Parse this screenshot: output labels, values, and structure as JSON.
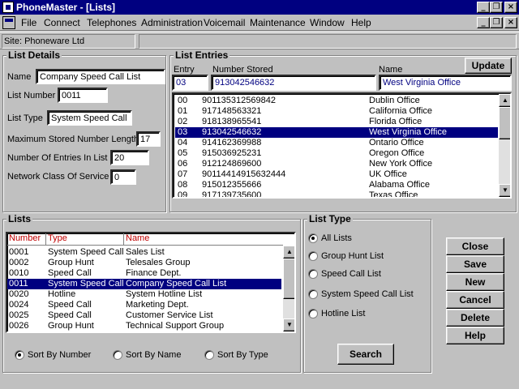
{
  "window": {
    "title": "PhoneMaster - [Lists]"
  },
  "menu": [
    "File",
    "Connect",
    "Telephones",
    "Administration",
    "Voicemail",
    "Maintenance",
    "Window",
    "Help"
  ],
  "site": {
    "label": "Site: Phoneware Ltd"
  },
  "list_details": {
    "title": "List Details",
    "name_label": "Name",
    "name_value": "Company Speed Call List",
    "number_label": "List Number",
    "number_value": "0011",
    "type_label": "List Type",
    "type_value": "System Speed Call",
    "max_len_label": "Maximum Stored Number Length",
    "max_len_value": "17",
    "entries_label": "Number Of Entries In List",
    "entries_value": "20",
    "ncos_label": "Network Class Of Service",
    "ncos_value": "0"
  },
  "list_entries": {
    "title": "List Entries",
    "update_label": "Update",
    "col_entry": "Entry",
    "col_number": "Number Stored",
    "col_name": "Name",
    "edit_entry": "03",
    "edit_number": "913042546632",
    "edit_name": "West Virginia Office",
    "rows": [
      {
        "entry": "00",
        "number": "901135312569842",
        "name": "Dublin Office"
      },
      {
        "entry": "01",
        "number": "917148563321",
        "name": "California Office"
      },
      {
        "entry": "02",
        "number": "918138965541",
        "name": "Florida Office"
      },
      {
        "entry": "03",
        "number": "913042546632",
        "name": "West Virginia Office"
      },
      {
        "entry": "04",
        "number": "914162369988",
        "name": "Ontario Office"
      },
      {
        "entry": "05",
        "number": "915036925231",
        "name": "Oregon Office"
      },
      {
        "entry": "06",
        "number": "912124869600",
        "name": "New York Office"
      },
      {
        "entry": "07",
        "number": "90114414915632444",
        "name": "UK Office"
      },
      {
        "entry": "08",
        "number": "915012355666",
        "name": "Alabama Office"
      },
      {
        "entry": "09",
        "number": "917139735600",
        "name": "Texas Office"
      }
    ],
    "selected_index": 3
  },
  "lists": {
    "title": "Lists",
    "col_number": "Number",
    "col_type": "Type",
    "col_name": "Name",
    "rows": [
      {
        "number": "0001",
        "type": "System Speed Call",
        "name": "Sales List"
      },
      {
        "number": "0002",
        "type": "Group Hunt",
        "name": "Telesales Group"
      },
      {
        "number": "0010",
        "type": "Speed Call",
        "name": "Finance Dept."
      },
      {
        "number": "0011",
        "type": "System Speed Call",
        "name": "Company Speed Call List"
      },
      {
        "number": "0020",
        "type": "Hotline",
        "name": "System Hotline List"
      },
      {
        "number": "0024",
        "type": "Speed Call",
        "name": "Marketing Dept."
      },
      {
        "number": "0025",
        "type": "Speed Call",
        "name": "Customer Service List"
      },
      {
        "number": "0026",
        "type": "Group Hunt",
        "name": "Technical Support Group"
      }
    ],
    "selected_index": 3,
    "sort": {
      "by_number": "Sort By Number",
      "by_name": "Sort By Name",
      "by_type": "Sort By Type",
      "selected": "number"
    }
  },
  "list_type": {
    "title": "List Type",
    "options": [
      "All Lists",
      "Group Hunt List",
      "Speed Call List",
      "System Speed Call List",
      "Hotline List"
    ],
    "selected_index": 0,
    "search_label": "Search"
  },
  "actions": {
    "close": "Close",
    "save": "Save",
    "new": "New",
    "cancel": "Cancel",
    "delete": "Delete",
    "help": "Help"
  }
}
